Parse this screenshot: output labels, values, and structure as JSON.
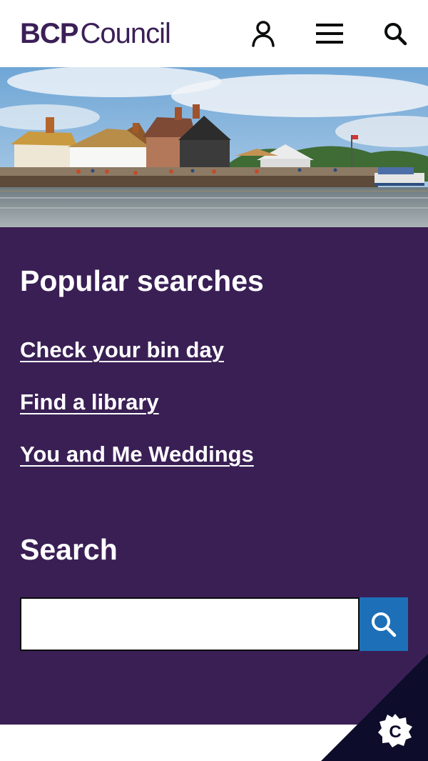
{
  "brand": {
    "logo_bold": "BCP",
    "logo_regular": "Council",
    "brand_color": "#3a1f55"
  },
  "header": {
    "icons": [
      "account-icon",
      "menu-icon",
      "search-icon"
    ]
  },
  "hero": {
    "alt": "Harbour waterfront with houses and a jetty"
  },
  "popular": {
    "heading": "Popular searches",
    "links": [
      {
        "label": "Check your bin day"
      },
      {
        "label": "Find a library"
      },
      {
        "label": "You and Me Weddings"
      }
    ]
  },
  "search": {
    "heading": "Search",
    "value": "",
    "placeholder": "",
    "button_color": "#1d70b8"
  },
  "cookie": {
    "icon": "cookie-settings-icon",
    "letter": "C"
  }
}
